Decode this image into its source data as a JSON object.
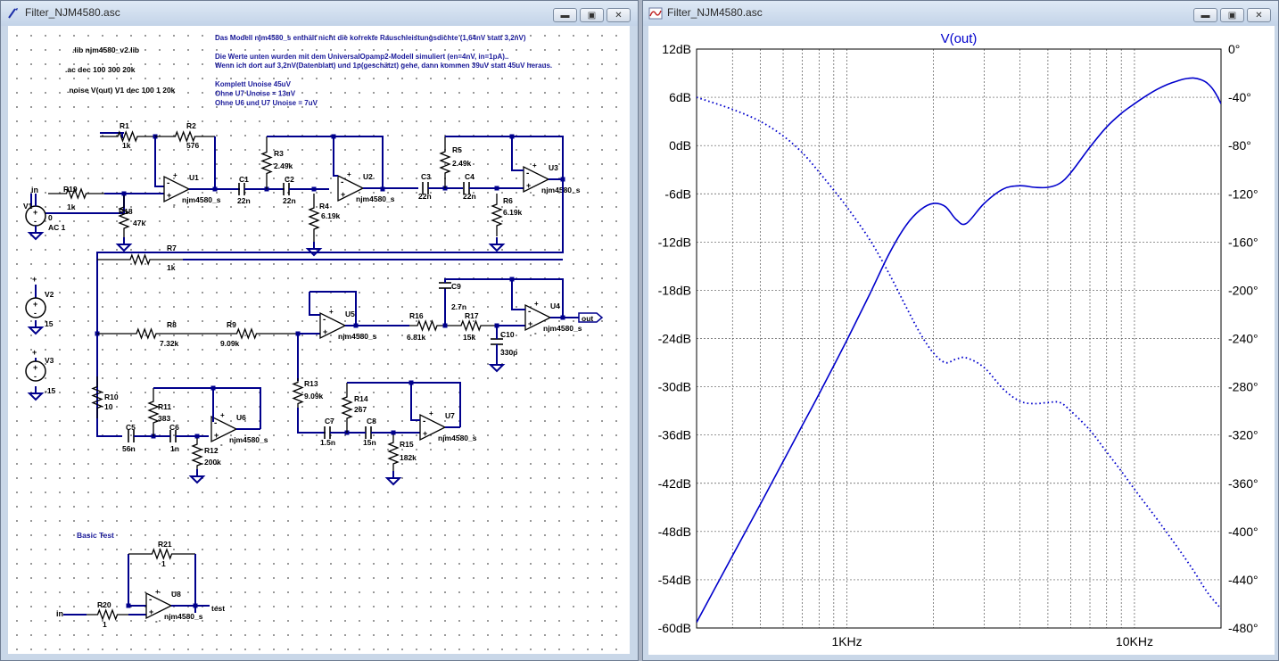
{
  "left_window": {
    "title": "Filter_NJM4580.asc",
    "directives": [
      ".lib njm4580_v2.lib",
      ".ac dec 100 300 20k",
      ".noise V(out) V1 dec 100 1 20k"
    ],
    "comment_lines": [
      "Das Modell njm4580_s enthält nicht die korrekte Rauschleistungsdichte (1,64nV statt 3,2nV)",
      "",
      "Die Werte unten wurden mit dem UniversalOpamp2-Modell simuliert (en=4nV, in=1pA)..",
      "Wenn ich dort auf 3,2nV(Datenblatt) und 1p(geschätzt) gehe, dann kommen 39uV statt 45uV heraus.",
      "",
      "Komplett Unoise 45uV",
      "Ohne U7 Unoise = 13uV",
      "Ohne U6 und U7 Unoise = 7uV"
    ],
    "basic_test_label": "Basic Test",
    "opamp_model": "njm4580_s",
    "opamps": [
      "U1",
      "U2",
      "U3",
      "U4",
      "U5",
      "U6",
      "U7",
      "U8"
    ],
    "resistors": {
      "R1": "1k",
      "R2": "576",
      "R3": "2.49k",
      "R4": "6.19k",
      "R5": "2.49k",
      "R6": "6.19k",
      "R7": "1k",
      "R8": "7.32k",
      "R9": "9.09k",
      "R10": "10",
      "R11": "383",
      "R12": "200k",
      "R13": "9.09k",
      "R14": "267",
      "R15": "182k",
      "R16": "6.81k",
      "R17": "15k",
      "R18": "47k",
      "R19": "1k",
      "R20": "1",
      "R21": "1"
    },
    "capacitors": {
      "C1": "22n",
      "C2": "22n",
      "C3": "22n",
      "C4": "22n",
      "C5": "56n",
      "C6": "1n",
      "C7": "1.5n",
      "C8": "15n",
      "C9": "2.7n",
      "C10": "330p"
    },
    "sources": {
      "V1": {
        "value": "0",
        "ac": "AC 1"
      },
      "V2": {
        "value": "15"
      },
      "V3": {
        "value": "-15"
      }
    },
    "net_labels": {
      "in": "in",
      "out": "out",
      "test": "test"
    }
  },
  "right_window": {
    "title": "Filter_NJM4580.asc",
    "chart_data": {
      "type": "line",
      "title": "V(out)",
      "x_scale": "log",
      "xlim": [
        300,
        20000
      ],
      "x_tick_labels": [
        "1KHz",
        "10KHz"
      ],
      "ylim_left": [
        -60,
        12
      ],
      "left_axis_labels": [
        "12dB",
        "6dB",
        "0dB",
        "-6dB",
        "-12dB",
        "-18dB",
        "-24dB",
        "-30dB",
        "-36dB",
        "-42dB",
        "-48dB",
        "-54dB",
        "-60dB"
      ],
      "ylim_right": [
        -480,
        0
      ],
      "right_axis_labels": [
        "0°",
        "-40°",
        "-80°",
        "-120°",
        "-160°",
        "-200°",
        "-240°",
        "-280°",
        "-320°",
        "-360°",
        "-400°",
        "-440°",
        "-480°"
      ],
      "grid": true,
      "colors": {
        "trace": "#0000cc",
        "grid": "#555555"
      },
      "series": [
        {
          "name": "magnitude",
          "axis": "left",
          "style": "solid",
          "x": [
            300,
            400,
            500,
            600,
            700,
            800,
            1000,
            1200,
            1400,
            1600,
            1800,
            2000,
            2200,
            2400,
            2600,
            3000,
            3500,
            4000,
            4500,
            5000,
            5500,
            6000,
            7000,
            8000,
            9000,
            10000,
            11000,
            12000,
            13000,
            14000,
            15000,
            16000,
            17000,
            18000,
            19000,
            20000
          ],
          "values": [
            -59.3,
            -51.0,
            -44.6,
            -39.3,
            -34.8,
            -30.9,
            -24.2,
            -18.5,
            -13.5,
            -10.0,
            -8.0,
            -7.2,
            -7.6,
            -9.2,
            -9.7,
            -7.2,
            -5.4,
            -5.0,
            -5.2,
            -5.2,
            -4.7,
            -3.4,
            -0.2,
            2.3,
            4.0,
            5.2,
            6.2,
            7.0,
            7.6,
            8.0,
            8.3,
            8.4,
            8.2,
            7.7,
            6.7,
            5.2
          ]
        },
        {
          "name": "phase",
          "axis": "right",
          "style": "dotted",
          "x": [
            300,
            400,
            500,
            600,
            700,
            800,
            900,
            1000,
            1200,
            1400,
            1600,
            1800,
            2000,
            2200,
            2400,
            2600,
            3000,
            3500,
            4000,
            4500,
            5000,
            5500,
            6000,
            7000,
            8000,
            9000,
            10000,
            11000,
            12000,
            14000,
            16000,
            18000,
            20000
          ],
          "values": [
            -40,
            -50,
            -60,
            -72,
            -86,
            -102,
            -117,
            -131,
            -158,
            -186,
            -213,
            -236,
            -252,
            -260,
            -257,
            -256,
            -264,
            -282,
            -292,
            -294,
            -293,
            -293,
            -300,
            -316,
            -334,
            -350,
            -365,
            -378,
            -390,
            -412,
            -432,
            -451,
            -464
          ]
        }
      ]
    }
  },
  "window_buttons": {
    "minimize": "▬",
    "maximize": "▣",
    "close": "✕"
  }
}
